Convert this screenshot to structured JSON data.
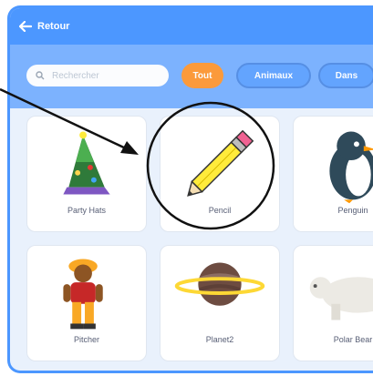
{
  "header": {
    "back_label": "Retour"
  },
  "search": {
    "placeholder": "Rechercher"
  },
  "filters": {
    "all": "Tout",
    "animals": "Animaux",
    "more": "Dans"
  },
  "sprites": [
    {
      "label": "Party Hats"
    },
    {
      "label": "Pencil"
    },
    {
      "label": "Penguin"
    },
    {
      "label": "Pitcher"
    },
    {
      "label": "Planet2"
    },
    {
      "label": "Polar Bear"
    }
  ],
  "colors": {
    "header": "#4c97ff",
    "filterbar": "#6aa8ff",
    "active_chip": "#ff8c1a",
    "background": "#e9f1fc"
  }
}
